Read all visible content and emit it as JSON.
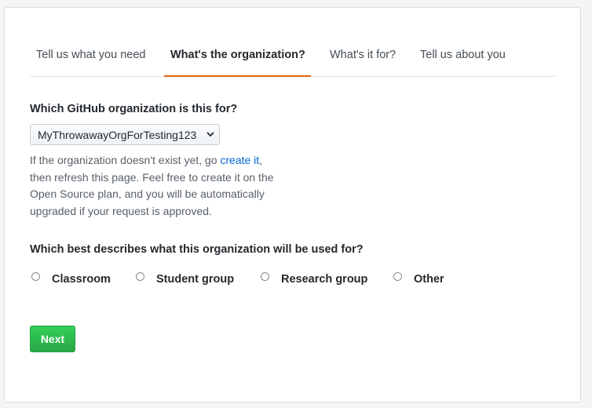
{
  "tabs": [
    {
      "label": "Tell us what you need",
      "active": false
    },
    {
      "label": "What's the organization?",
      "active": true
    },
    {
      "label": "What's it for?",
      "active": false
    },
    {
      "label": "Tell us about you",
      "active": false
    }
  ],
  "organization": {
    "question": "Which GitHub organization is this for?",
    "selected": "MyThrowawayOrgForTesting123",
    "help_lines": [
      "If the organization doesn't exist yet, go ",
      "create it",
      ",",
      "then refresh this page. Feel free to create it on the",
      "Open Source plan, and you will be automatically",
      "upgraded if your request is approved."
    ]
  },
  "usage": {
    "question": "Which best describes what this organization will be used for?",
    "options": [
      "Classroom",
      "Student group",
      "Research group",
      "Other"
    ]
  },
  "actions": {
    "next_label": "Next"
  },
  "colors": {
    "active_tab_underline": "#e36209",
    "link": "#0366d6",
    "primary_button": "#28a745"
  }
}
